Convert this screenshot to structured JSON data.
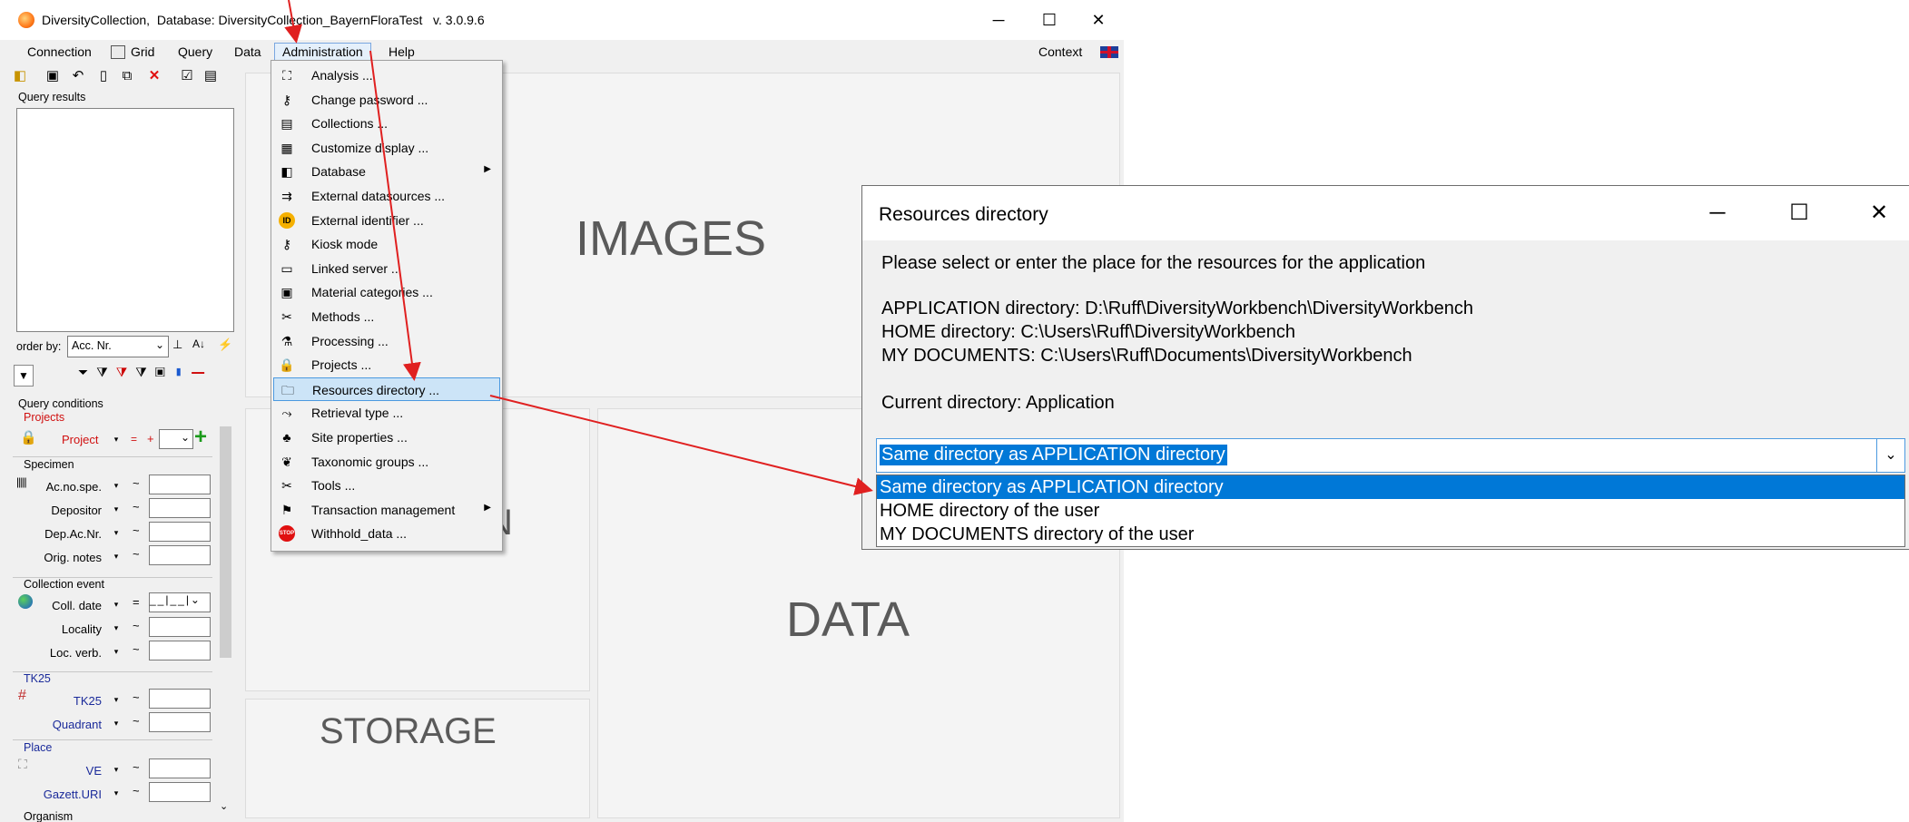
{
  "window": {
    "title": "DiversityCollection,  Database: DiversityCollection_BayernFloraTest   v. 3.0.9.6",
    "minimize": "─",
    "maximize": "☐",
    "close": "✕"
  },
  "menubar": {
    "items": [
      "Connection",
      "Grid",
      "Query",
      "Data",
      "Administration",
      "Help"
    ],
    "context": "Context"
  },
  "leftpanel": {
    "query_results_label": "Query results",
    "order_by_label": "order by:",
    "order_by_value": "Acc. Nr.",
    "query_conditions_label": "Query conditions",
    "projects_group": "Projects",
    "project_field": "Project",
    "project_eq": "=",
    "project_plus": "+",
    "specimen_group": "Specimen",
    "specimen_fields": [
      "Ac.no.spe.",
      "Depositor",
      "Dep.Ac.Nr.",
      "Orig. notes"
    ],
    "collection_event_group": "Collection event",
    "coll_date": "Coll. date",
    "coll_date_eq": "=",
    "event_fields": [
      "Locality",
      "Loc. verb."
    ],
    "tk25_group": "TK25",
    "tk25_fields": [
      "TK25",
      "Quadrant"
    ],
    "place_group": "Place",
    "place_fields": [
      "VE",
      "Gazett.URI"
    ],
    "organism_group": "Organism",
    "tilde": "~"
  },
  "content": {
    "images_label": "IMAGES",
    "data_label": "DATA",
    "storage_label": "STORAGE",
    "partial_n": "N"
  },
  "admin_menu": {
    "items": [
      {
        "label": "Analysis ...",
        "icon": "analysis-icon",
        "glyph": "⛶"
      },
      {
        "label": "Change password ...",
        "icon": "key-icon",
        "glyph": "⚷"
      },
      {
        "label": "Collections ...",
        "icon": "collections-icon",
        "glyph": "▤"
      },
      {
        "label": "Customize display ...",
        "icon": "display-icon",
        "glyph": "▦"
      },
      {
        "label": "Database",
        "icon": "database-icon",
        "glyph": "◧",
        "submenu": true
      },
      {
        "label": "External datasources ...",
        "icon": "external-datasource-icon",
        "glyph": "⇉"
      },
      {
        "label": "External identifier ...",
        "icon": "id-icon",
        "glyph": "ID"
      },
      {
        "label": "Kiosk mode",
        "icon": "kiosk-icon",
        "glyph": "⚷"
      },
      {
        "label": "Linked server ...",
        "icon": "server-icon",
        "glyph": "▭"
      },
      {
        "label": "Material categories ...",
        "icon": "material-icon",
        "glyph": "▣"
      },
      {
        "label": "Methods ...",
        "icon": "methods-icon",
        "glyph": "✂"
      },
      {
        "label": "Processing ...",
        "icon": "processing-icon",
        "glyph": "⚗"
      },
      {
        "label": "Projects ...",
        "icon": "lock-icon",
        "glyph": "🔒"
      },
      {
        "label": "Resources directory ...",
        "icon": "folder-icon",
        "glyph": "🗀"
      },
      {
        "label": "Retrieval type ...",
        "icon": "retrieval-icon",
        "glyph": "⤳"
      },
      {
        "label": "Site properties ...",
        "icon": "site-icon",
        "glyph": "♣"
      },
      {
        "label": "Taxonomic groups ...",
        "icon": "leaf-icon",
        "glyph": "❦"
      },
      {
        "label": "Tools ...",
        "icon": "tools-icon",
        "glyph": "✂"
      },
      {
        "label": "Transaction management",
        "icon": "transaction-icon",
        "glyph": "⚑",
        "submenu": true
      },
      {
        "label": "Withhold_data ...",
        "icon": "stop-icon",
        "glyph": "STOP"
      }
    ],
    "submenu_arrow": "▶"
  },
  "dialog": {
    "title": "Resources directory",
    "prompt": "Please select or enter the place for the resources for the application",
    "application_dir": "APPLICATION directory: D:\\Ruff\\DiversityWorkbench\\DiversityWorkbench",
    "home_dir": "HOME directory: C:\\Users\\Ruff\\DiversityWorkbench",
    "documents_dir": "MY DOCUMENTS: C:\\Users\\Ruff\\Documents\\DiversityWorkbench",
    "current": "Current directory: Application",
    "selected": "Same directory as APPLICATION directory",
    "options": [
      "Same directory as APPLICATION directory",
      "HOME directory of the user",
      "MY DOCUMENTS directory of the user"
    ],
    "combo_arrow": "⌄",
    "minimize": "─",
    "maximize": "☐",
    "close": "✕"
  },
  "colors": {
    "annotation_arrow": "#e02020",
    "selection": "#0078d7",
    "menu_highlight": "#cce4f7"
  }
}
